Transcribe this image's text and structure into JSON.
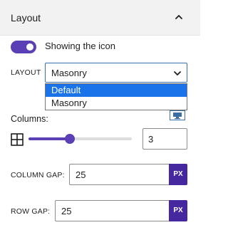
{
  "panel": {
    "title": "Layout"
  },
  "toggle": {
    "label": "Showing the icon",
    "checked": true
  },
  "layout_select": {
    "label": "LAYOUT",
    "value": "Masonry",
    "options": [
      "Default",
      "Masonry"
    ],
    "highlighted": "Default"
  },
  "columns": {
    "label": "Columns:",
    "value": "3",
    "slider_fraction": 0.4
  },
  "column_gap": {
    "label": "COLUMN GAP:",
    "value": "25",
    "unit": "PX"
  },
  "row_gap": {
    "label": "ROW GAP:",
    "value": "25",
    "unit": "PX"
  },
  "colors": {
    "accent": "#5b3fb4",
    "unit_button": "#4527a0",
    "highlight": "#1a73e8"
  }
}
